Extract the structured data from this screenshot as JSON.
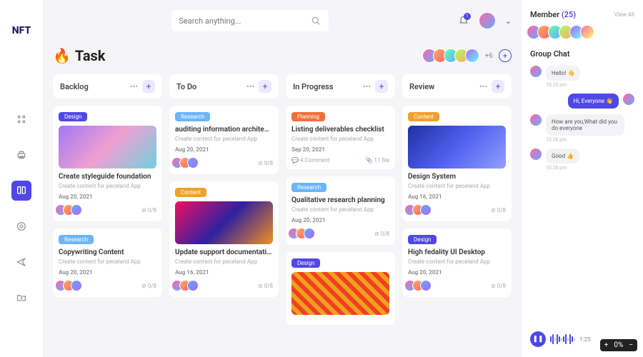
{
  "brand": "NFT",
  "search": {
    "placeholder": "Search anything..."
  },
  "notifications": {
    "count": 1
  },
  "page": {
    "icon": "🔥",
    "title": "Task",
    "extra_members": "+6"
  },
  "columns": [
    {
      "title": "Backlog",
      "cards": [
        {
          "tag": "Design",
          "tag_class": "design",
          "image": "img-a",
          "title": "Create styleguide foundation",
          "sub": "Create content for peceland App",
          "date": "Aug 20, 2021",
          "count": "0/8"
        },
        {
          "tag": "Research",
          "tag_class": "research",
          "title": "Copywriting Content",
          "sub": "Create content for peceland App",
          "date": "Aug 20, 2021",
          "count": "0/8"
        }
      ]
    },
    {
      "title": "To Do",
      "cards": [
        {
          "tag": "Research",
          "tag_class": "research",
          "title": "auditing information architecture",
          "sub": "Create content for peceland App",
          "date": "Aug 20, 2021",
          "count": "0/8"
        },
        {
          "tag": "Content",
          "tag_class": "content",
          "image": "img-c",
          "title": "Update support documentation",
          "sub": "Create content for peceland App",
          "date": "Aug 16, 2021",
          "count": "0/8"
        }
      ]
    },
    {
      "title": "In Progress",
      "cards": [
        {
          "tag": "Planning",
          "tag_class": "planning",
          "title": "Listing deliverables checklist",
          "sub": "Create content for peceland App",
          "date": "Sep 20, 2021",
          "count": "",
          "meta_left": "💬 4 Comment",
          "meta_right": "📎 11 file"
        },
        {
          "tag": "Research",
          "tag_class": "research",
          "title": "Qualitative research planning",
          "sub": "Create content for peceland App",
          "date": "Aug 20, 2021",
          "count": "0/8"
        },
        {
          "tag": "Design",
          "tag_class": "design",
          "image": "img-d",
          "title": "",
          "sub": "",
          "date": "",
          "count": ""
        }
      ]
    },
    {
      "title": "Review",
      "cards": [
        {
          "tag": "Content",
          "tag_class": "content",
          "image": "img-b",
          "title": "Design System",
          "sub": "Create content for peceland App",
          "date": "Aug 16, 2021",
          "count": "0/8"
        },
        {
          "tag": "Design",
          "tag_class": "design",
          "title": "High fedality UI Desktop",
          "sub": "Create content for peceland App",
          "date": "Aug 20, 2021",
          "count": "0/8"
        }
      ]
    }
  ],
  "members": {
    "title": "Member",
    "count": "(25)",
    "view_all": "View All"
  },
  "chat": {
    "title": "Group Chat",
    "messages": [
      {
        "side": "left",
        "text": "Hello! 👋",
        "time": "10:25 pm"
      },
      {
        "side": "right",
        "text": "Hi, Everyone 👋",
        "time": ""
      },
      {
        "side": "left",
        "text": "How are you,What did you do everyone",
        "time": "10:28 pm"
      },
      {
        "side": "left",
        "text": "Good 👍",
        "time": "10:28 pm"
      }
    ],
    "audio_duration": "1:25"
  },
  "zoom": {
    "value": "0%"
  }
}
